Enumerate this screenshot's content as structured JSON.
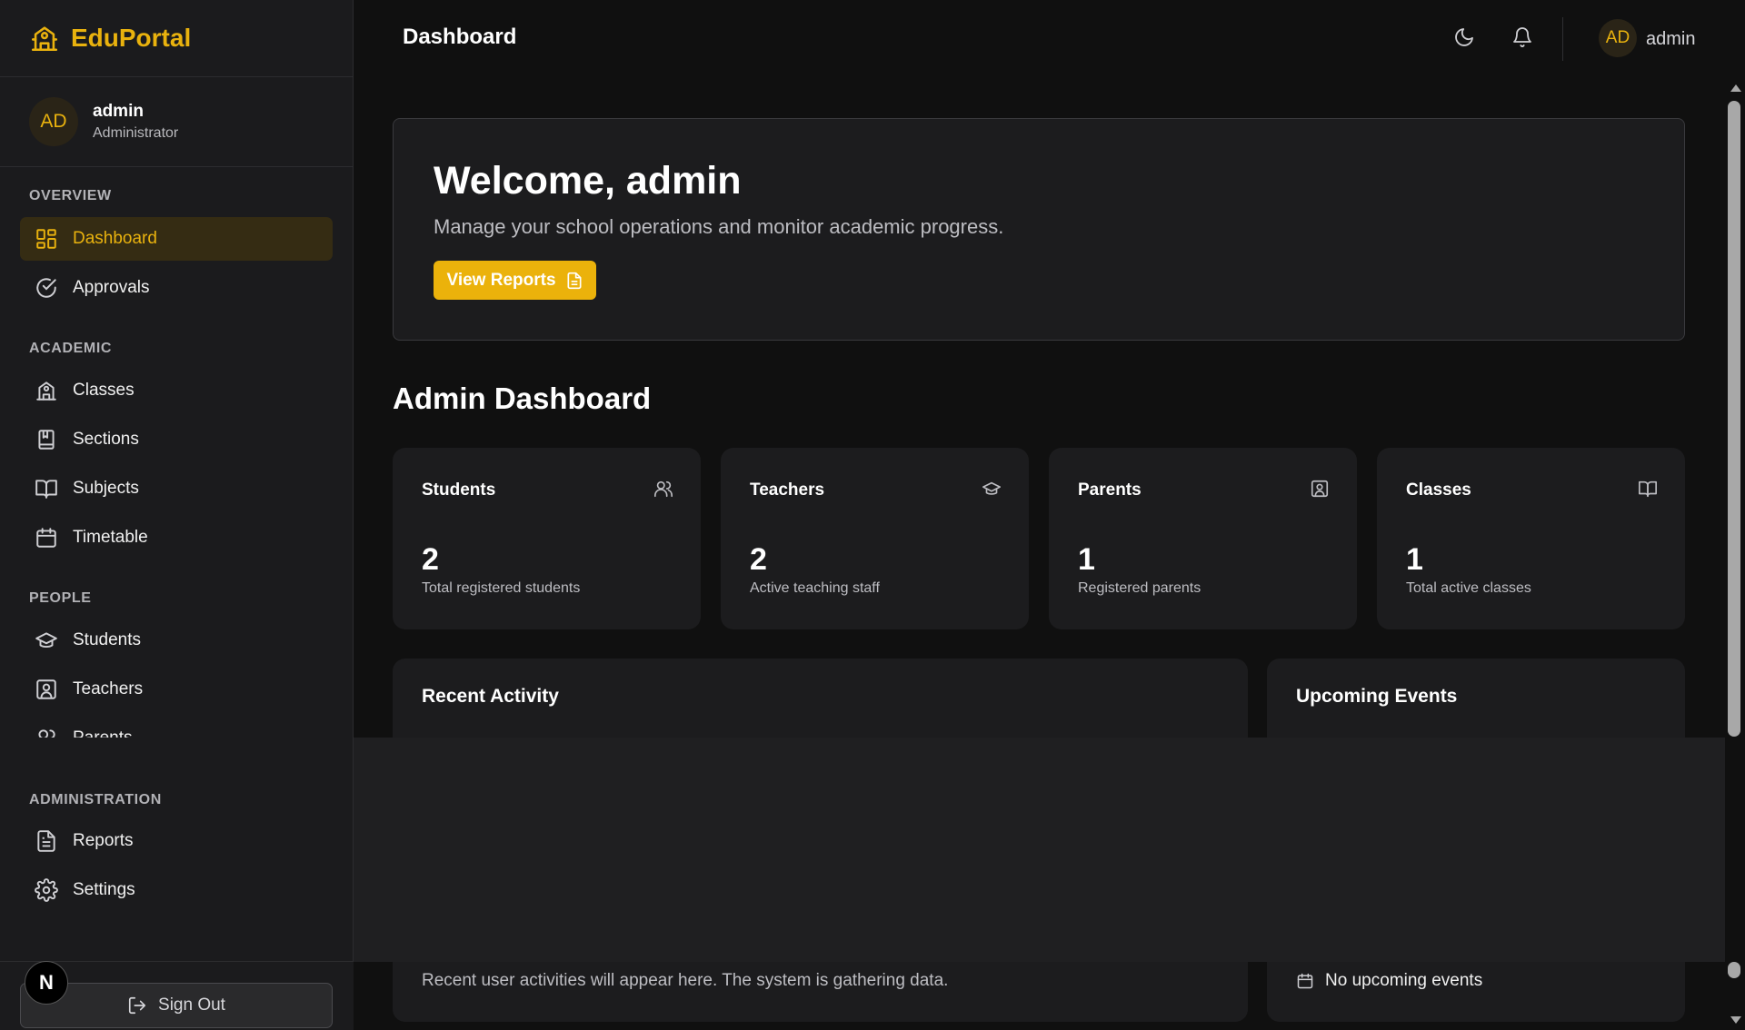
{
  "app": {
    "name": "EduPortal"
  },
  "user": {
    "initials": "AD",
    "name": "admin",
    "role": "Administrator"
  },
  "sidebar": {
    "sections": [
      {
        "title": "OVERVIEW"
      },
      {
        "title": "ACADEMIC"
      },
      {
        "title": "PEOPLE"
      },
      {
        "title": "ADMINISTRATION"
      }
    ],
    "items": [
      {
        "label": "Dashboard",
        "icon": "dashboard-grid-icon",
        "active": true
      },
      {
        "label": "Approvals",
        "icon": "check-circle-icon"
      },
      {
        "label": "Classes",
        "icon": "school-building-icon"
      },
      {
        "label": "Sections",
        "icon": "bookmark-book-icon"
      },
      {
        "label": "Subjects",
        "icon": "open-book-icon"
      },
      {
        "label": "Timetable",
        "icon": "calendar-icon"
      },
      {
        "label": "Students",
        "icon": "graduation-cap-icon"
      },
      {
        "label": "Teachers",
        "icon": "id-badge-icon"
      },
      {
        "label": "Parents",
        "icon": "users-icon"
      },
      {
        "label": "Reports",
        "icon": "document-icon"
      },
      {
        "label": "Settings",
        "icon": "gear-icon"
      }
    ],
    "sign_out": "Sign Out",
    "dev_badge": "N"
  },
  "header": {
    "title": "Dashboard",
    "theme_icon": "moon-icon",
    "notification_icon": "bell-icon",
    "user_initials": "AD",
    "user_name": "admin"
  },
  "welcome": {
    "title": "Welcome, admin",
    "subtitle": "Manage your school operations and monitor academic progress.",
    "button": "View Reports"
  },
  "dashboard": {
    "heading": "Admin Dashboard",
    "stats": [
      {
        "label": "Students",
        "value": "2",
        "desc": "Total registered students",
        "icon": "users-icon"
      },
      {
        "label": "Teachers",
        "value": "2",
        "desc": "Active teaching staff",
        "icon": "graduation-cap-icon"
      },
      {
        "label": "Parents",
        "value": "1",
        "desc": "Registered parents",
        "icon": "id-badge-icon"
      },
      {
        "label": "Classes",
        "value": "1",
        "desc": "Total active classes",
        "icon": "open-book-icon"
      }
    ],
    "recent_activity": {
      "title": "Recent Activity",
      "text": "Recent user activities will appear here. The system is gathering data."
    },
    "upcoming_events": {
      "title": "Upcoming Events",
      "text": "No upcoming events"
    }
  },
  "colors": {
    "accent": "#e9b20e",
    "background": "#101010",
    "card": "#1c1c1e"
  }
}
